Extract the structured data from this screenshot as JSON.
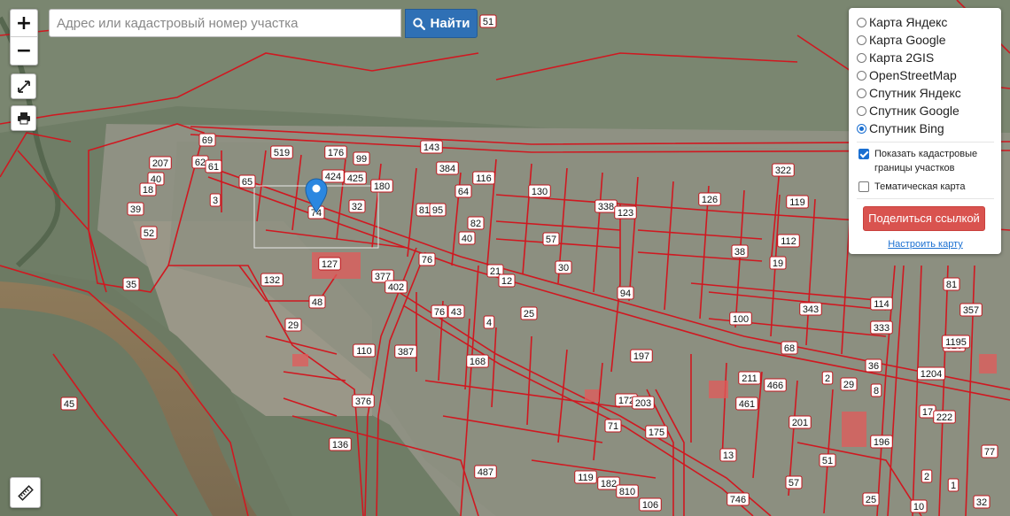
{
  "search": {
    "placeholder": "Адрес или кадастровый номер участка",
    "button_label": "Найти"
  },
  "controls": {
    "zoom_in": "+",
    "zoom_out": "−"
  },
  "layers": {
    "options": [
      "Карта Яндекс",
      "Карта Google",
      "Карта 2GIS",
      "OpenStreetMap",
      "Спутник Яндекс",
      "Спутник Google",
      "Спутник Bing"
    ],
    "selected": "Спутник Bing",
    "show_cadastre_label": "Показать кадастровые границы участков",
    "show_cadastre_checked": true,
    "thematic_label": "Тематическая карта",
    "thematic_checked": false,
    "share_label": "Поделиться ссылкой",
    "settings_label": "Настроить карту"
  },
  "map": {
    "parcel_numbers": [
      "51",
      "519",
      "176",
      "99",
      "143",
      "69",
      "62",
      "61",
      "65",
      "424",
      "425",
      "180",
      "384",
      "116",
      "207",
      "40",
      "18",
      "39",
      "3",
      "74",
      "32",
      "81",
      "95",
      "64",
      "82",
      "130",
      "338",
      "123",
      "126",
      "322",
      "119",
      "52",
      "127",
      "57",
      "76",
      "40",
      "38",
      "112",
      "19",
      "35",
      "132",
      "377",
      "402",
      "21",
      "12",
      "30",
      "94",
      "343",
      "114",
      "100",
      "333",
      "81",
      "357",
      "326",
      "29",
      "48",
      "43",
      "4",
      "25",
      "110",
      "387",
      "76",
      "68",
      "36",
      "1204",
      "1195",
      "45",
      "376",
      "168",
      "197",
      "211",
      "466",
      "29",
      "2",
      "8",
      "17",
      "172",
      "203",
      "71",
      "175",
      "461",
      "201",
      "222",
      "196",
      "136",
      "13",
      "487",
      "119",
      "182",
      "810",
      "106",
      "746",
      "57",
      "51",
      "77",
      "2",
      "1",
      "25",
      "32",
      "10"
    ]
  },
  "colors": {
    "accent": "#2f70b5",
    "share": "#d9534f",
    "parcel": "#d01820",
    "marker": "#2b87e0"
  }
}
